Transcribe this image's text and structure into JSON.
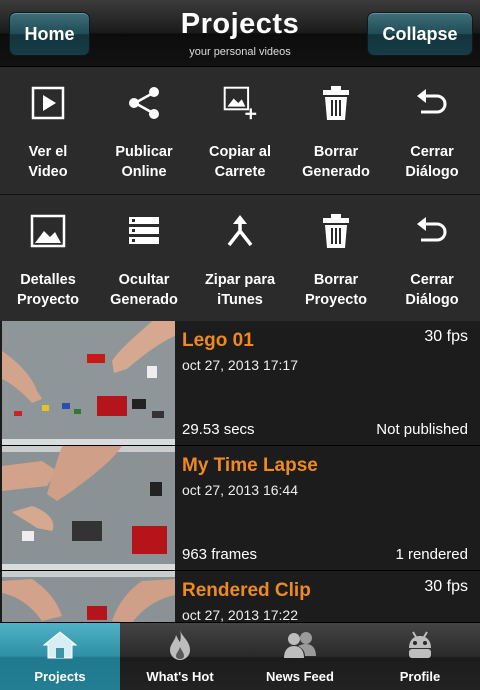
{
  "header": {
    "home_label": "Home",
    "title": "Projects",
    "subtitle": "your personal videos",
    "collapse_label": "Collapse"
  },
  "actions_row1": [
    {
      "label": "Ver el\nVideo",
      "icon": "play-icon"
    },
    {
      "label": "Publicar\nOnline",
      "icon": "share-icon"
    },
    {
      "label": "Copiar al\nCarrete",
      "icon": "image-add-icon"
    },
    {
      "label": "Borrar\nGenerado",
      "icon": "trash-icon"
    },
    {
      "label": "Cerrar\nDiálogo",
      "icon": "undo-icon"
    }
  ],
  "actions_row2": [
    {
      "label": "Detalles\nProyecto",
      "icon": "image-icon"
    },
    {
      "label": "Ocultar\nGenerado",
      "icon": "server-icon"
    },
    {
      "label": "Zipar para\niTunes",
      "icon": "merge-icon"
    },
    {
      "label": "Borrar\nProyecto",
      "icon": "trash-icon"
    },
    {
      "label": "Cerrar\nDiálogo",
      "icon": "undo-icon"
    }
  ],
  "projects": [
    {
      "title": "Lego 01",
      "fps": "30 fps",
      "date": "oct 27, 2013 17:17",
      "length": "29.53 secs",
      "status": "Not published"
    },
    {
      "title": "My Time Lapse",
      "fps": "",
      "date": "oct 27, 2013 16:44",
      "length": "963 frames",
      "status": "1 rendered"
    },
    {
      "title": "Rendered Clip",
      "fps": "30 fps",
      "date": "oct 27, 2013 17:22",
      "length": "",
      "status": ""
    }
  ],
  "tabs": [
    {
      "label": "Projects",
      "icon": "house-icon",
      "active": true
    },
    {
      "label": "What's Hot",
      "icon": "flame-icon",
      "active": false
    },
    {
      "label": "News Feed",
      "icon": "people-icon",
      "active": false
    },
    {
      "label": "Profile",
      "icon": "android-icon",
      "active": false
    }
  ]
}
